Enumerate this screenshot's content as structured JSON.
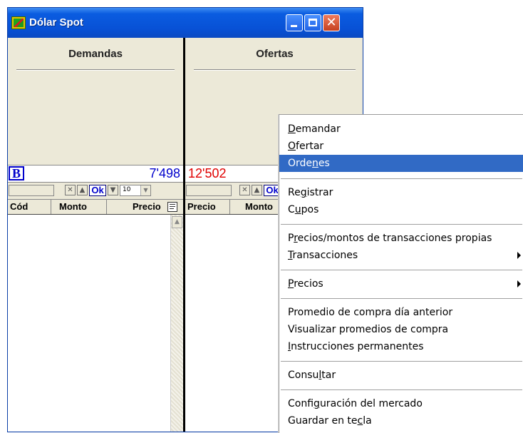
{
  "window": {
    "title": "Dólar Spot"
  },
  "panes": {
    "left": {
      "title": "Demandas",
      "total": "7'498",
      "badge": "B"
    },
    "right": {
      "title": "Ofertas",
      "total": "12'502"
    }
  },
  "controls": {
    "ok_label": "Ok",
    "lot_value": "10"
  },
  "columns": {
    "left": [
      "Cód",
      "Monto",
      "Precio"
    ],
    "right": [
      "Precio",
      "Monto"
    ]
  },
  "context_menu": {
    "items": [
      {
        "pre": "",
        "u": "D",
        "post": "emandar"
      },
      {
        "pre": "",
        "u": "O",
        "post": "fertar"
      },
      {
        "pre": "Orde",
        "u": "n",
        "post": "es",
        "highlighted": true
      },
      {
        "pre": "Re",
        "u": "g",
        "post": "istrar"
      },
      {
        "pre": "C",
        "u": "u",
        "post": "pos"
      },
      {
        "pre": "P",
        "u": "r",
        "post": "ecios/montos de transacciones propias"
      },
      {
        "pre": "",
        "u": "T",
        "post": "ransacciones",
        "submenu": true
      },
      {
        "pre": "",
        "u": "P",
        "post": "recios",
        "submenu": true
      },
      {
        "pre": "Promedio de compra día anterior",
        "u": "",
        "post": ""
      },
      {
        "pre": "Visualizar promedios de compra",
        "u": "",
        "post": ""
      },
      {
        "pre": "",
        "u": "I",
        "post": "nstrucciones permanentes"
      },
      {
        "pre": "Consu",
        "u": "l",
        "post": "tar"
      },
      {
        "pre": "Confi",
        "u": "g",
        "post": "uración del mercado"
      },
      {
        "pre": "Guardar en te",
        "u": "c",
        "post": "la"
      }
    ]
  },
  "colors": {
    "accent": "#316ac5",
    "buy_blue": "#0000cc",
    "sell_red": "#e00000"
  }
}
